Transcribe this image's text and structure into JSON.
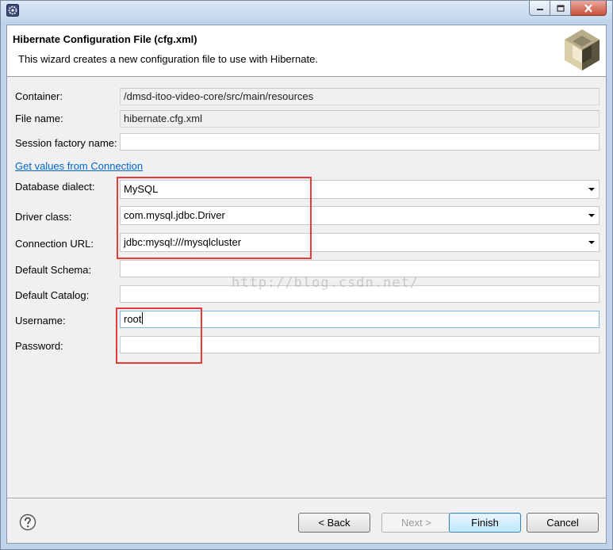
{
  "header": {
    "title": "Hibernate Configuration File (cfg.xml)",
    "description": "This wizard creates a new configuration file to use with Hibernate."
  },
  "form": {
    "container": {
      "label": "Container:",
      "value": "/dmsd-itoo-video-core/src/main/resources"
    },
    "file_name": {
      "label": "File name:",
      "value": "hibernate.cfg.xml"
    },
    "session_factory_name": {
      "label": "Session factory name:",
      "value": ""
    },
    "get_values_link": "Get values from Connection",
    "database_dialect": {
      "label": "Database dialect:",
      "value": "MySQL"
    },
    "driver_class": {
      "label": "Driver class:",
      "value": "com.mysql.jdbc.Driver"
    },
    "connection_url": {
      "label": "Connection URL:",
      "value": "jdbc:mysql:///mysqlcluster"
    },
    "default_schema": {
      "label": "Default Schema:",
      "value": ""
    },
    "default_catalog": {
      "label": "Default Catalog:",
      "value": ""
    },
    "username": {
      "label": "Username:",
      "value": "root"
    },
    "password": {
      "label": "Password:",
      "value": ""
    }
  },
  "watermark": "http://blog.csdn.net/",
  "buttons": {
    "back": "< Back",
    "next": "Next >",
    "finish": "Finish",
    "cancel": "Cancel"
  },
  "icons": {
    "app": "eclipse-app-icon",
    "logo": "hibernate-logo-icon",
    "help": "help-icon",
    "minimize": "minimize-icon",
    "maximize": "maximize-icon",
    "close": "close-icon"
  },
  "colors": {
    "highlight_box": "#e53b3b",
    "link": "#0066cc"
  }
}
